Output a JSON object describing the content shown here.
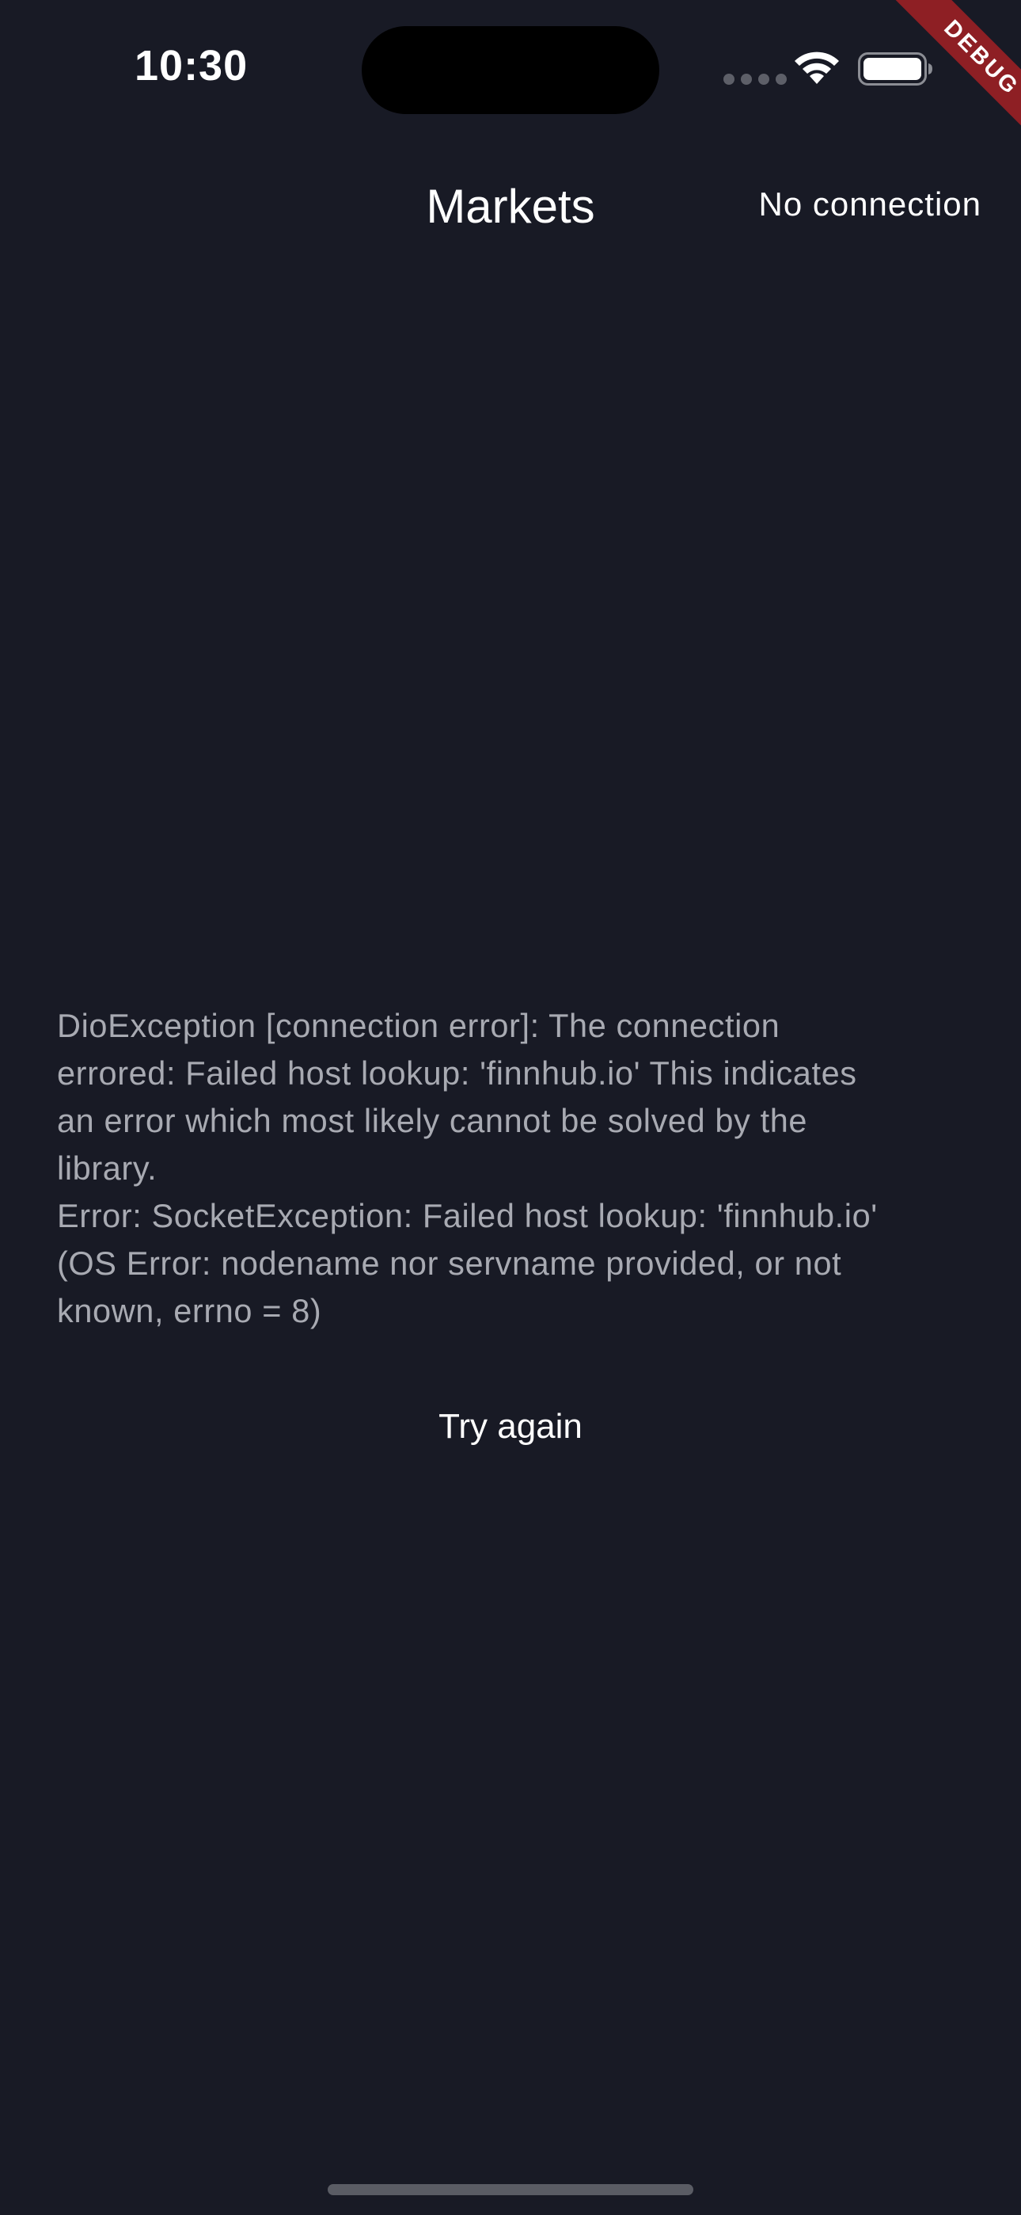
{
  "status_bar": {
    "time": "10:30",
    "icons": [
      "cellular-signal-icon",
      "wifi-icon",
      "battery-icon"
    ]
  },
  "debug_banner": {
    "label": "DEBUG",
    "color": "#8e1f24"
  },
  "app_bar": {
    "title": "Markets",
    "connection_status": "No connection"
  },
  "error": {
    "lines": [
      "DioException [connection error]: The connection",
      "errored: Failed host lookup: 'finnhub.io' This indicates",
      "an error which most likely cannot be solved by the",
      "library.",
      "Error: SocketException: Failed host lookup: 'finnhub.io'",
      "(OS Error: nodename nor servname provided, or not",
      "known, errno = 8)"
    ],
    "retry_label": "Try again"
  },
  "colors": {
    "background": "#181a25",
    "text_primary": "#ffffff",
    "text_secondary": "#a8aab2"
  }
}
